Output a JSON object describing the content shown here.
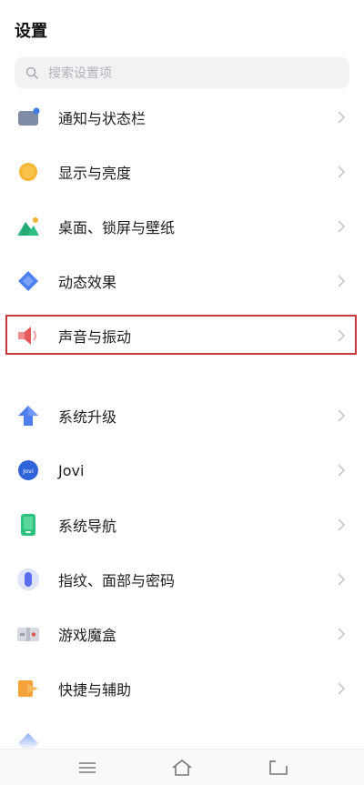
{
  "header": {
    "title": "设置"
  },
  "search": {
    "placeholder": "搜索设置项"
  },
  "items": [
    {
      "label": "通知与状态栏",
      "icon": "notification-statusbar-icon"
    },
    {
      "label": "显示与亮度",
      "icon": "display-brightness-icon"
    },
    {
      "label": "桌面、锁屏与壁纸",
      "icon": "wallpaper-icon"
    },
    {
      "label": "动态效果",
      "icon": "motion-effects-icon"
    },
    {
      "label": "声音与振动",
      "icon": "sound-vibration-icon",
      "highlighted": true
    },
    {
      "label": "系统升级",
      "icon": "system-update-icon"
    },
    {
      "label": "Jovi",
      "icon": "jovi-icon"
    },
    {
      "label": "系统导航",
      "icon": "system-navigation-icon"
    },
    {
      "label": "指纹、面部与密码",
      "icon": "fingerprint-icon"
    },
    {
      "label": "游戏魔盒",
      "icon": "game-box-icon"
    },
    {
      "label": "快捷与辅助",
      "icon": "shortcuts-assist-icon"
    }
  ],
  "colors": {
    "highlight_border": "#c8373b",
    "accent_blue": "#3d7be8"
  }
}
